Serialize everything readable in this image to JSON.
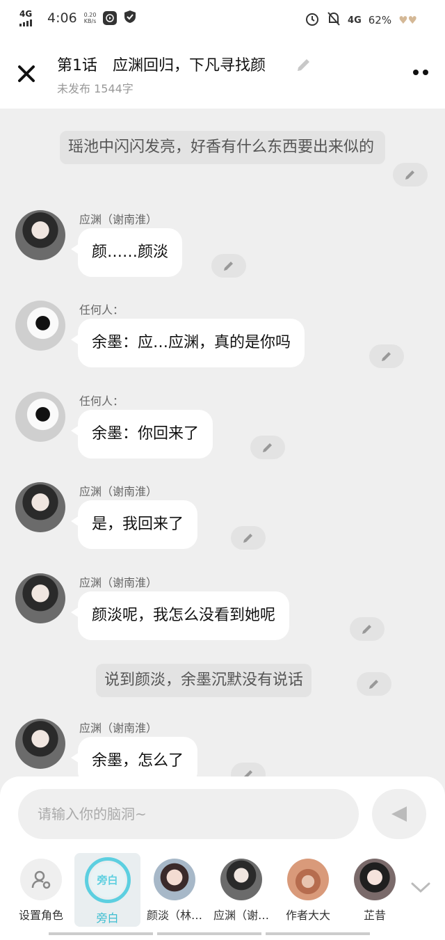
{
  "status": {
    "network": "4G",
    "time": "4:06",
    "speed_top": "0.20",
    "speed_bottom": "KB/s",
    "right_net": "4G",
    "battery": "62%"
  },
  "header": {
    "title": "第1话　应渊回归，下凡寻找颜",
    "subtitle": "未发布 1544字"
  },
  "chat": {
    "narration1": "瑶池中闪闪发亮，好香有什么东西要出来似的",
    "messages": [
      {
        "speaker": "应渊（谢南淮）",
        "text": "颜……颜淡"
      },
      {
        "speaker": "任何人：",
        "text": "余墨：应…应渊，真的是你吗"
      },
      {
        "speaker": "任何人：",
        "text": "余墨：你回来了"
      },
      {
        "speaker": "应渊（谢南淮）",
        "text": "是，我回来了"
      },
      {
        "speaker": "应渊（谢南淮）",
        "text": "颜淡呢，我怎么没看到她呢"
      },
      {
        "speaker": "应渊（谢南淮）",
        "text": "余墨，怎么了"
      }
    ],
    "narration2": "说到颜淡，余墨沉默没有说话"
  },
  "input": {
    "placeholder": "请输入你的脑洞~"
  },
  "roles": [
    {
      "label": "设置角色"
    },
    {
      "label": "旁白",
      "badge": "旁白"
    },
    {
      "label": "颜淡（林…"
    },
    {
      "label": "应渊（谢…"
    },
    {
      "label": "作者大大"
    },
    {
      "label": "芷昔"
    }
  ],
  "colors": {
    "accent": "#5ccfe0",
    "background": "#efefef",
    "bubble": "#ffffff"
  }
}
